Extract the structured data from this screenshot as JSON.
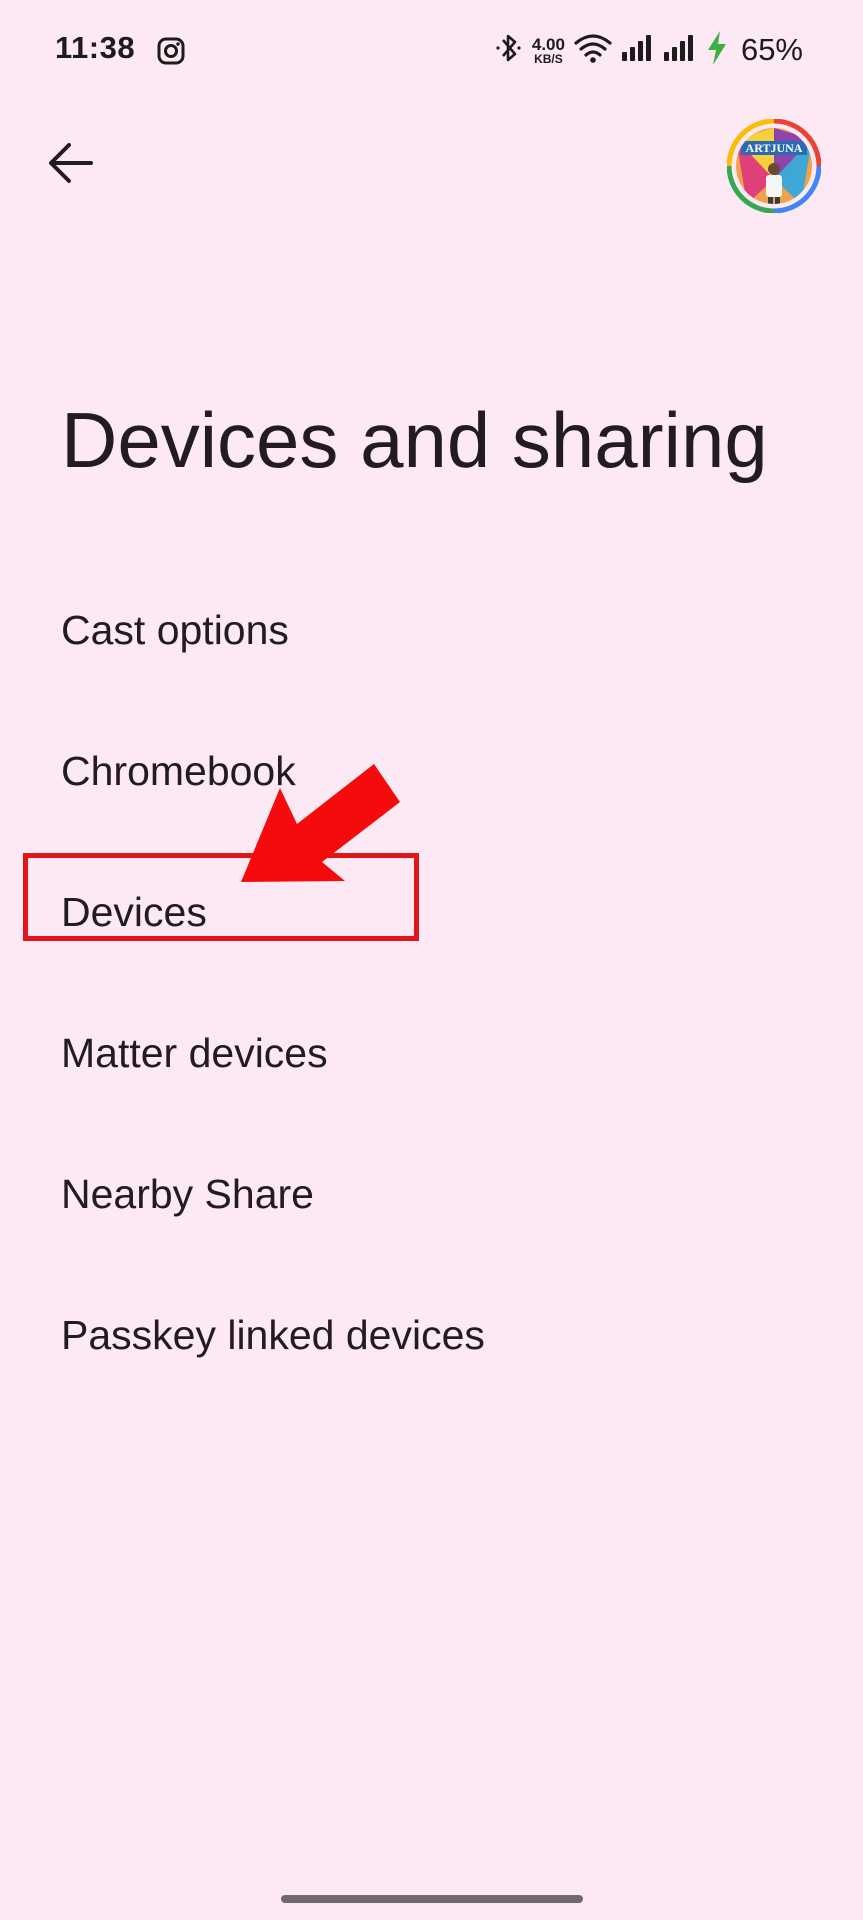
{
  "status_bar": {
    "time": "11:38",
    "app_icon": "instagram-icon",
    "net_speed_value": "4.00",
    "net_speed_unit": "KB/S",
    "battery_percent": "65%",
    "icons": [
      "bluetooth-icon",
      "wifi-icon",
      "signal-icon",
      "signal-icon",
      "charging-icon"
    ]
  },
  "app_bar": {
    "back_icon": "arrow-back-icon",
    "avatar_text": "ARTJUNA"
  },
  "page": {
    "title": "Devices and sharing"
  },
  "settings": {
    "items": [
      {
        "label": "Cast options"
      },
      {
        "label": "Chromebook"
      },
      {
        "label": "Devices"
      },
      {
        "label": "Matter devices"
      },
      {
        "label": "Nearby Share"
      },
      {
        "label": "Passkey linked devices"
      }
    ]
  },
  "annotation": {
    "highlighted_item": "Devices",
    "color": "#e4141b"
  },
  "colors": {
    "background": "#fde9f3",
    "text": "#221c20",
    "charging": "#3cb043"
  }
}
